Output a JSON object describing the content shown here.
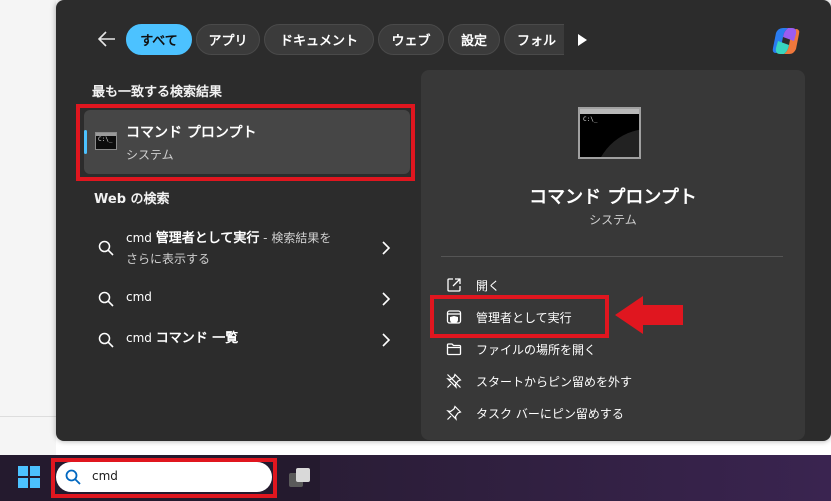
{
  "filters": {
    "items": [
      {
        "label": "すべて",
        "active": true
      },
      {
        "label": "アプリ",
        "active": false
      },
      {
        "label": "ドキュメント",
        "active": false
      },
      {
        "label": "ウェブ",
        "active": false
      },
      {
        "label": "設定",
        "active": false
      },
      {
        "label": "フォル",
        "active": false
      }
    ]
  },
  "best_match": {
    "heading": "最も一致する検索結果",
    "title": "コマンド プロンプト",
    "subtitle": "システム"
  },
  "web": {
    "heading": "Web の検索",
    "results": [
      {
        "query": "cmd",
        "bold": "管理者として実行",
        "suffix": " - 検索結果を",
        "line2": "さらに表示する"
      },
      {
        "query": "cmd",
        "bold": "",
        "suffix": "",
        "line2": ""
      },
      {
        "query": "cmd",
        "bold": "コマンド 一覧",
        "suffix": "",
        "line2": ""
      }
    ]
  },
  "detail": {
    "title": "コマンド プロンプト",
    "subtitle": "システム",
    "actions": [
      {
        "label": "開く",
        "icon": "open-external-icon"
      },
      {
        "label": "管理者として実行",
        "icon": "shield-admin-icon"
      },
      {
        "label": "ファイルの場所を開く",
        "icon": "folder-icon"
      },
      {
        "label": "スタートからピン留めを外す",
        "icon": "unpin-icon"
      },
      {
        "label": "タスク バーにピン留めする",
        "icon": "pin-icon"
      }
    ]
  },
  "taskbar": {
    "search_value": "cmd"
  },
  "colors": {
    "accent": "#4cc2ff",
    "highlight_red": "#e0161f",
    "panel": "#2c2c2c"
  }
}
